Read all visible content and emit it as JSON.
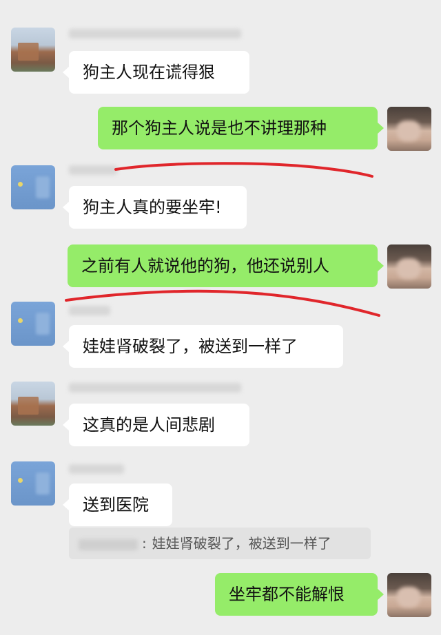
{
  "messages": [
    {
      "side": "left",
      "text": "狗主人现在谎得狠"
    },
    {
      "side": "right",
      "text": "那个狗主人说是也不讲理那种"
    },
    {
      "side": "left",
      "text": "狗主人真的要坐牢!"
    },
    {
      "side": "right",
      "text": "之前有人就说他的狗，他还说别人"
    },
    {
      "side": "left",
      "text": "娃娃肾破裂了，被送到一样了"
    },
    {
      "side": "left",
      "text": "这真的是人间悲剧"
    },
    {
      "side": "left",
      "text": "送到医院"
    },
    {
      "side": "right",
      "text": "坐牢都不能解恨"
    }
  ],
  "quote": {
    "separator": ":",
    "text": "娃娃肾破裂了，被送到一样了"
  },
  "colors": {
    "background": "#ededed",
    "sent_bubble": "#95ec69",
    "received_bubble": "#ffffff",
    "annotation_line": "#e0262b"
  }
}
